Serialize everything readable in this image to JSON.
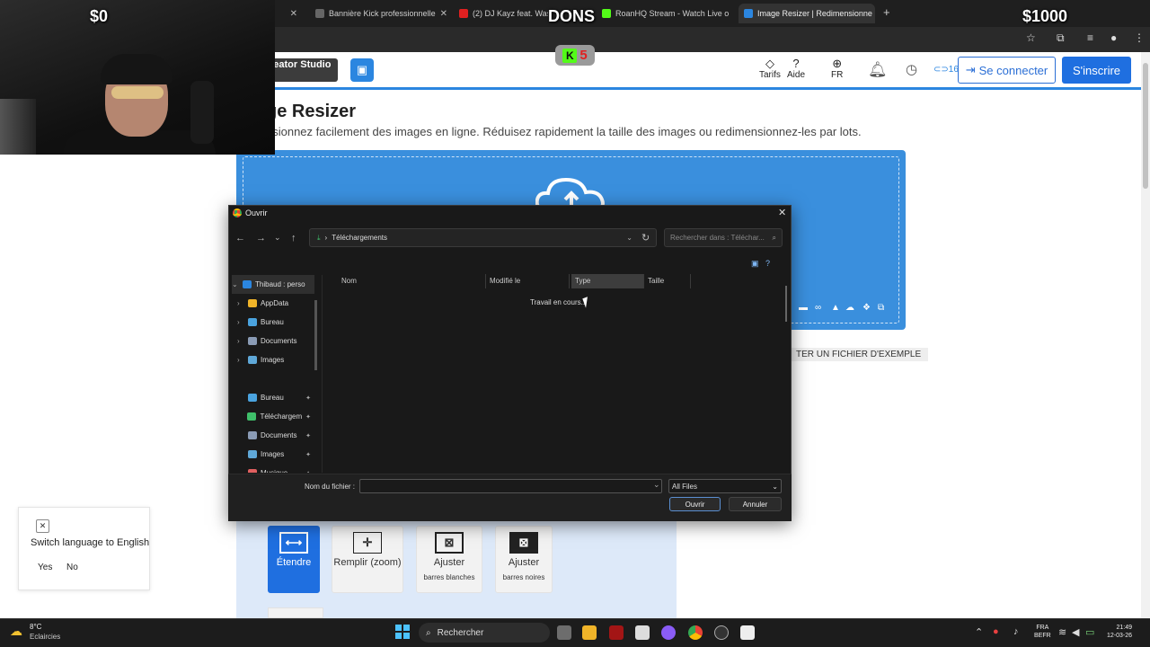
{
  "browser": {
    "tabs": [
      {
        "label": "Bannière Kick professionnelle"
      },
      {
        "label": "(2) DJ Kayz feat. Wassila"
      },
      {
        "label": "RoanHQ Stream - Watch Live o"
      },
      {
        "label": "Image Resizer | Redimensionne"
      }
    ]
  },
  "site": {
    "studio_label": "reator Studio 2",
    "nav": {
      "tarifs": "Tarifs",
      "aide": "Aide",
      "lang": "FR",
      "credits": "16",
      "login": "Se connecter",
      "signup": "S'inscrire"
    },
    "title": "ge Resizer",
    "subtitle": "nsionnez facilement des images en ligne. Réduisez rapidement la taille des images ou redimensionnez-les par lots.",
    "sample_link": "TER UN FICHIER D'EXEMPLE",
    "modes": [
      {
        "label": "Étendre",
        "sub": ""
      },
      {
        "label": "Remplir (zoom)",
        "sub": ""
      },
      {
        "label": "Ajuster",
        "sub": "barres blanches"
      },
      {
        "label": "Ajuster",
        "sub": "barres noires"
      }
    ]
  },
  "lang_popup": {
    "text": "Switch language to English",
    "yes": "Yes",
    "no": "No"
  },
  "dialog": {
    "title": "Ouvrir",
    "path": "Téléchargements",
    "search_placeholder": "Rechercher dans : Téléchar...",
    "nav_items": [
      {
        "label": "Thibaud : perso",
        "icon": "onedrive-icon",
        "expandable": true,
        "pinned": false,
        "selected": true
      },
      {
        "label": "AppData",
        "icon": "folder-icon",
        "expandable": true,
        "pinned": false
      },
      {
        "label": "Bureau",
        "icon": "desktop-icon",
        "expandable": true,
        "pinned": false
      },
      {
        "label": "Documents",
        "icon": "documents-icon",
        "expandable": true,
        "pinned": false
      },
      {
        "label": "Images",
        "icon": "images-icon",
        "expandable": true,
        "pinned": false
      },
      {
        "label": "",
        "icon": "",
        "expandable": false,
        "pinned": false
      },
      {
        "label": "Bureau",
        "icon": "desktop-icon",
        "expandable": false,
        "pinned": true
      },
      {
        "label": "Téléchargem",
        "icon": "download-icon",
        "expandable": false,
        "pinned": true
      },
      {
        "label": "Documents",
        "icon": "documents-icon",
        "expandable": false,
        "pinned": true
      },
      {
        "label": "Images",
        "icon": "images-icon",
        "expandable": false,
        "pinned": true
      },
      {
        "label": "Musique",
        "icon": "music-icon",
        "expandable": false,
        "pinned": true
      }
    ],
    "columns": {
      "name": "Nom",
      "modified": "Modifié le",
      "type": "Type",
      "size": "Taille"
    },
    "status": "Travail en cours...",
    "filename_label": "Nom du fichier :",
    "filename_value": "",
    "filter": "All Files",
    "open": "Ouvrir",
    "cancel": "Annuler"
  },
  "overlay": {
    "left_amount": "$0",
    "center_label": "DONS",
    "right_amount": "$1000",
    "badge_letter": "K",
    "badge_number": "5"
  },
  "taskbar": {
    "weather_temp": "8°C",
    "weather_desc": "Eclaircies",
    "search": "Rechercher",
    "lang_line1": "FRA",
    "lang_line2": "BEFR",
    "time": "21:49",
    "date": "12-03-26"
  },
  "colors": {
    "accent": "#2b86e0",
    "dialog_bg": "#191919",
    "kick_green": "#53fc18"
  }
}
